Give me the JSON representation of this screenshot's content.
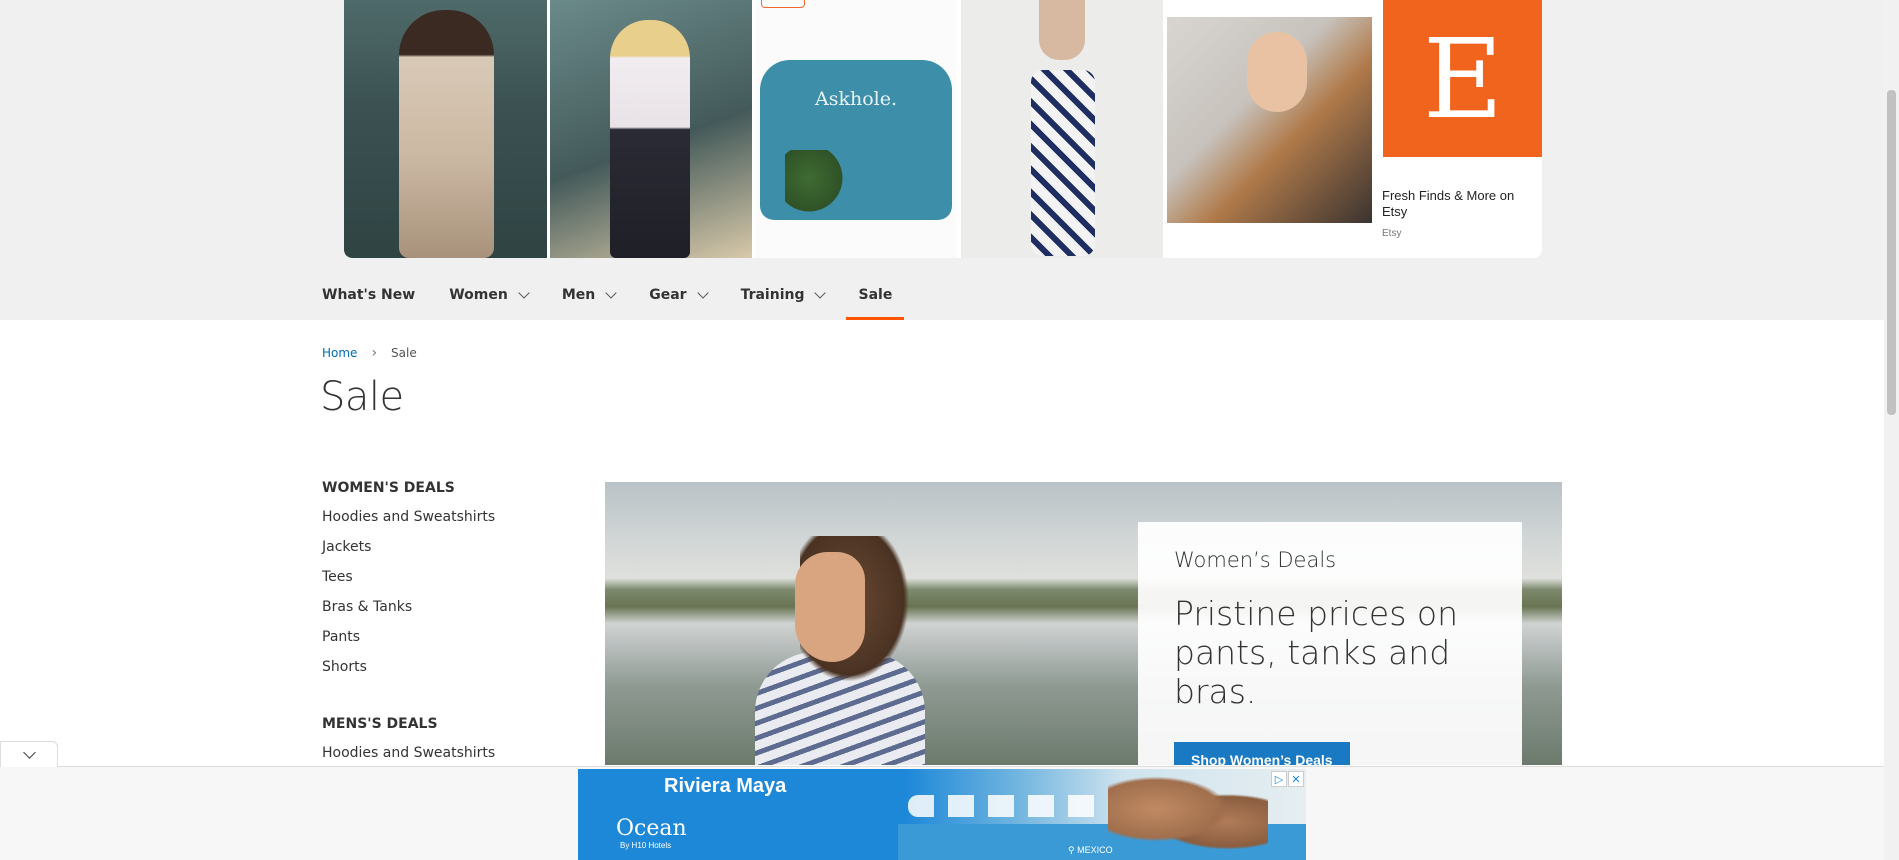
{
  "top_ads": {
    "tiles": [
      {
        "name": "ad-photo-woman-gown"
      },
      {
        "name": "ad-photo-woman-tv"
      },
      {
        "name": "ad-photo-shirt",
        "shirt_text": "Askhole."
      },
      {
        "name": "ad-photo-pants"
      },
      {
        "name": "ad-photo-signed"
      },
      {
        "name": "ad-etsy",
        "logo_letter": "E",
        "title": "Fresh Finds & More on Etsy",
        "source": "Etsy"
      }
    ]
  },
  "nav": {
    "items": [
      {
        "label": "What's New",
        "has_dropdown": false,
        "active": false
      },
      {
        "label": "Women",
        "has_dropdown": true,
        "active": false
      },
      {
        "label": "Men",
        "has_dropdown": true,
        "active": false
      },
      {
        "label": "Gear",
        "has_dropdown": true,
        "active": false
      },
      {
        "label": "Training",
        "has_dropdown": true,
        "active": false
      },
      {
        "label": "Sale",
        "has_dropdown": false,
        "active": true
      }
    ],
    "accent_color": "#ff5501"
  },
  "breadcrumb": {
    "home": "Home",
    "current": "Sale"
  },
  "page": {
    "title": "Sale"
  },
  "sidebar": {
    "womens_heading": "WOMEN'S DEALS",
    "womens_links": [
      "Hoodies and Sweatshirts",
      "Jackets",
      "Tees",
      "Bras & Tanks",
      "Pants",
      "Shorts"
    ],
    "mens_heading": "MENS'S DEALS",
    "mens_links": [
      "Hoodies and Sweatshirts"
    ]
  },
  "hero": {
    "eyebrow": "Women’s Deals",
    "headline": "Pristine prices on pants, tanks and bras.",
    "button_label": "Shop Women’s Deals",
    "button_color": "#1979c3"
  },
  "bottom_ad": {
    "title": "Riviera Maya",
    "brand": "Ocean",
    "brand_sub": "By H10 Hotels",
    "location": "MEXICO",
    "adchoices_icon": "adchoices-icon",
    "close_icon": "close-icon"
  }
}
